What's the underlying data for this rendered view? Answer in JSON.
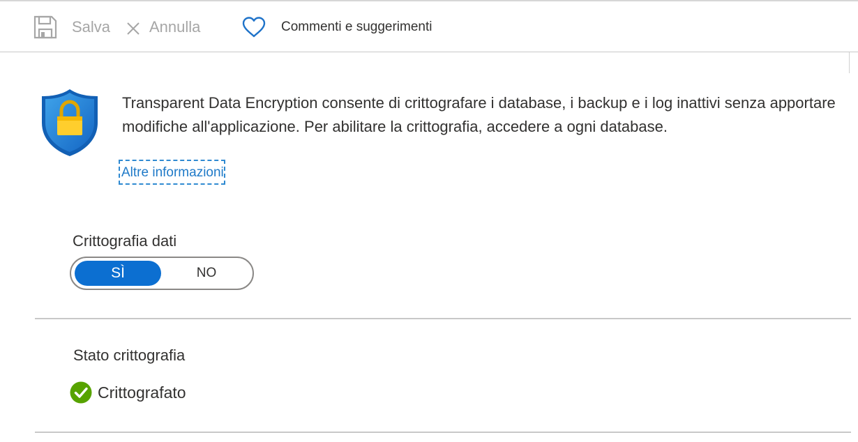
{
  "toolbar": {
    "save_label": "Salva",
    "cancel_label": "Annulla",
    "feedback_label": "Commenti e suggerimenti",
    "save_icon": "save-icon",
    "cancel_icon": "close-icon",
    "feedback_icon": "heart-icon"
  },
  "intro": {
    "icon": "shield-lock-icon",
    "description": "Transparent Data Encryption consente di crittografare i database, i backup e i log inattivi senza apportare modifiche all'applicazione. Per abilitare la crittografia, accedere a ogni database.",
    "learn_more": "Altre informazioni"
  },
  "encryption": {
    "label": "Crittografia dati",
    "options": [
      "SÌ",
      "NO"
    ],
    "selected": "SÌ"
  },
  "status": {
    "label": "Stato crittografia",
    "value": "Crittografato",
    "icon": "check-circle-icon",
    "color": "#57a300"
  },
  "colors": {
    "accent": "#0c6fd1",
    "link": "#1f7ac8"
  }
}
